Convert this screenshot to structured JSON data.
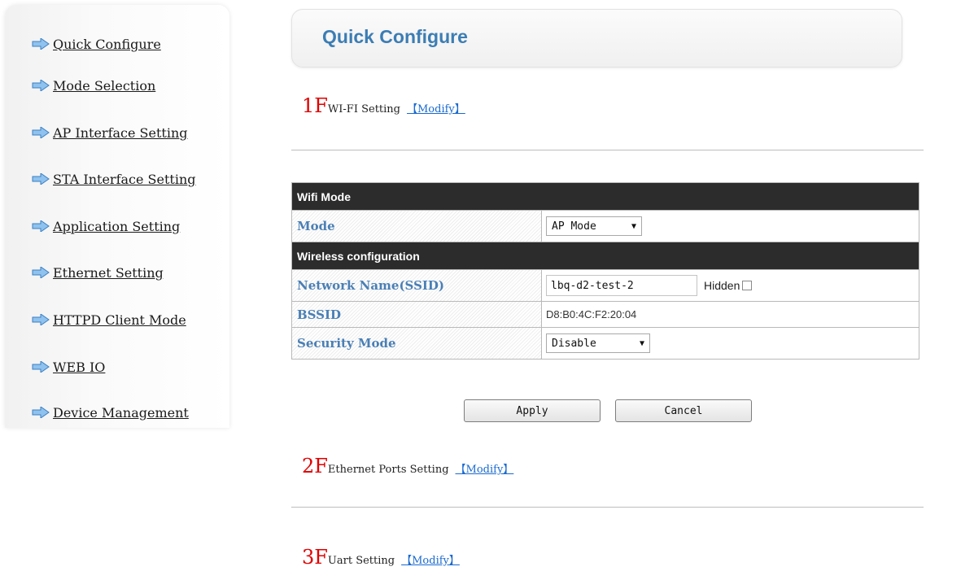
{
  "sidebar": {
    "items": [
      {
        "label": "Quick Configure"
      },
      {
        "label": "Mode Selection"
      },
      {
        "label": "AP Interface Setting"
      },
      {
        "label": "STA Interface Setting"
      },
      {
        "label": "Application Setting"
      },
      {
        "label": "Ethernet Setting"
      },
      {
        "label": "HTTPD Client Mode"
      },
      {
        "label": "WEB IO"
      },
      {
        "label": "Device Management"
      }
    ],
    "item_icon": "arrow-right-icon"
  },
  "header": {
    "title": "Quick Configure"
  },
  "sections": [
    {
      "number": "1F",
      "title": "WI-FI Setting",
      "modify": "【Modify】"
    },
    {
      "number": "2F",
      "title": "Ethernet Ports Setting",
      "modify": "【Modify】"
    },
    {
      "number": "3F",
      "title": "Uart Setting",
      "modify": "【Modify】"
    }
  ],
  "wifi": {
    "mode_header": "Wifi Mode",
    "mode_label": "Mode",
    "mode_value": "AP Mode",
    "wireless_header": "Wireless configuration",
    "ssid_label": "Network Name(SSID)",
    "ssid_value": "lbq-d2-test-2",
    "hidden_label": "Hidden",
    "hidden_checked": false,
    "bssid_label": "BSSID",
    "bssid_value": "D8:B0:4C:F2:20:04",
    "security_label": "Security Mode",
    "security_value": "Disable"
  },
  "buttons": {
    "apply": "Apply",
    "cancel": "Cancel"
  },
  "colors": {
    "accent_blue": "#3c7db4",
    "floor_number_red": "#e00000",
    "link_blue": "#1a6ad0",
    "section_header_bg": "#2c2c2c"
  }
}
